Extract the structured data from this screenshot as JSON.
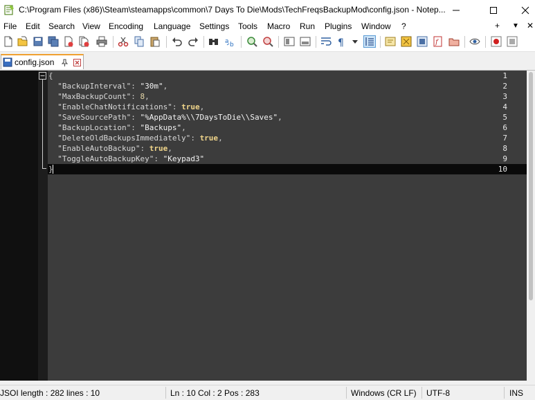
{
  "window": {
    "title": "C:\\Program Files (x86)\\Steam\\steamapps\\common\\7 Days To Die\\Mods\\TechFreqsBackupMod\\config.json - Notep...",
    "minimize": "—",
    "maximize": "☐",
    "close": "✕"
  },
  "menu": {
    "items": [
      "File",
      "Edit",
      "Search",
      "View",
      "Encoding",
      "Language",
      "Settings",
      "Tools",
      "Macro",
      "Run",
      "Plugins",
      "Window",
      "?"
    ],
    "plus": "+",
    "dropdown": "▼",
    "close": "✕"
  },
  "toolbar": {
    "icons": [
      "new-file-icon",
      "open-file-icon",
      "save-icon",
      "save-all-icon",
      "close-icon",
      "close-all-icon",
      "print-icon",
      "cut-icon",
      "copy-icon",
      "paste-icon",
      "undo-icon",
      "redo-icon",
      "find-icon",
      "replace-icon",
      "zoom-in-icon",
      "zoom-out-icon",
      "sync-vertical-icon",
      "sync-horizontal-icon",
      "word-wrap-icon",
      "show-all-chars-icon",
      "indent-guide-icon",
      "udl-icon",
      "doc-map-icon",
      "function-list-icon",
      "folder-workspace-icon",
      "monitoring-icon",
      "record-macro-icon",
      "stop-macro-icon"
    ]
  },
  "tab": {
    "label": "config.json"
  },
  "editor": {
    "line_numbers": [
      "1",
      "2",
      "3",
      "4",
      "5",
      "6",
      "7",
      "8",
      "9",
      "10"
    ],
    "lines": [
      [
        {
          "t": "{",
          "c": "p"
        }
      ],
      [
        {
          "t": "  ",
          "c": "p"
        },
        {
          "t": "\"BackupInterval\"",
          "c": "k"
        },
        {
          "t": ": ",
          "c": "p"
        },
        {
          "t": "\"30m\"",
          "c": "s"
        },
        {
          "t": ",",
          "c": "p"
        }
      ],
      [
        {
          "t": "  ",
          "c": "p"
        },
        {
          "t": "\"MaxBackupCount\"",
          "c": "k"
        },
        {
          "t": ": ",
          "c": "p"
        },
        {
          "t": "8",
          "c": "n"
        },
        {
          "t": ",",
          "c": "p"
        }
      ],
      [
        {
          "t": "  ",
          "c": "p"
        },
        {
          "t": "\"EnableChatNotifications\"",
          "c": "k"
        },
        {
          "t": ": ",
          "c": "p"
        },
        {
          "t": "true",
          "c": "b"
        },
        {
          "t": ",",
          "c": "p"
        }
      ],
      [
        {
          "t": "  ",
          "c": "p"
        },
        {
          "t": "\"SaveSourcePath\"",
          "c": "k"
        },
        {
          "t": ": ",
          "c": "p"
        },
        {
          "t": "\"%AppData%\\\\7DaysToDie\\\\Saves\"",
          "c": "s"
        },
        {
          "t": ",",
          "c": "p"
        }
      ],
      [
        {
          "t": "  ",
          "c": "p"
        },
        {
          "t": "\"BackupLocation\"",
          "c": "k"
        },
        {
          "t": ": ",
          "c": "p"
        },
        {
          "t": "\"Backups\"",
          "c": "s"
        },
        {
          "t": ",",
          "c": "p"
        }
      ],
      [
        {
          "t": "  ",
          "c": "p"
        },
        {
          "t": "\"DeleteOldBackupsImmediately\"",
          "c": "k"
        },
        {
          "t": ": ",
          "c": "p"
        },
        {
          "t": "true",
          "c": "b"
        },
        {
          "t": ",",
          "c": "p"
        }
      ],
      [
        {
          "t": "  ",
          "c": "p"
        },
        {
          "t": "\"EnableAutoBackup\"",
          "c": "k"
        },
        {
          "t": ": ",
          "c": "p"
        },
        {
          "t": "true",
          "c": "b"
        },
        {
          "t": ",",
          "c": "p"
        }
      ],
      [
        {
          "t": "  ",
          "c": "p"
        },
        {
          "t": "\"ToggleAutoBackupKey\"",
          "c": "k"
        },
        {
          "t": ": ",
          "c": "p"
        },
        {
          "t": "\"Keypad3\"",
          "c": "s"
        }
      ],
      [
        {
          "t": "}",
          "c": "p"
        }
      ]
    ]
  },
  "status": {
    "type_length": "JSOI length : 282    lines : 10",
    "position": "Ln : 10    Col : 2    Pos : 283",
    "eol": "Windows (CR LF)",
    "encoding": "UTF-8",
    "mode": "INS"
  },
  "colors": {
    "editor_bg": "#3c3c3c",
    "gutter_bg": "#101010",
    "current_line": "#0a0a0a",
    "tab_accent": "#f0a030"
  }
}
